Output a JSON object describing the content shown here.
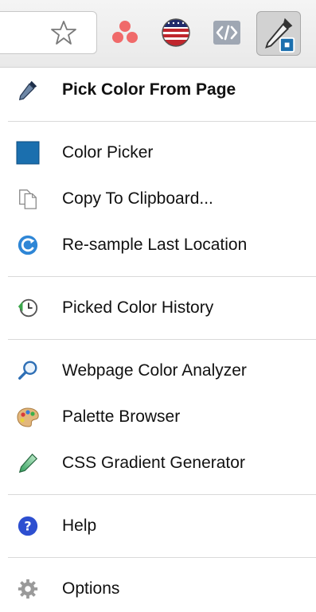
{
  "menu": {
    "sections": [
      [
        {
          "label": "Pick Color From Page",
          "icon": "eyedropper-icon",
          "bold": true
        }
      ],
      [
        {
          "label": "Color Picker",
          "icon": "color-swatch-icon"
        },
        {
          "label": "Copy To Clipboard...",
          "icon": "copy-documents-icon"
        },
        {
          "label": "Re-sample Last Location",
          "icon": "refresh-icon"
        }
      ],
      [
        {
          "label": "Picked Color History",
          "icon": "history-clock-icon"
        }
      ],
      [
        {
          "label": "Webpage Color Analyzer",
          "icon": "magnifier-icon"
        },
        {
          "label": "Palette Browser",
          "icon": "palette-icon"
        },
        {
          "label": "CSS Gradient Generator",
          "icon": "gradient-pen-icon"
        }
      ],
      [
        {
          "label": "Help",
          "icon": "help-icon"
        }
      ],
      [
        {
          "label": "Options",
          "icon": "gear-icon"
        }
      ]
    ]
  },
  "colors": {
    "swatch": "#1b6fae",
    "accent_blue": "#2e7bd6"
  }
}
